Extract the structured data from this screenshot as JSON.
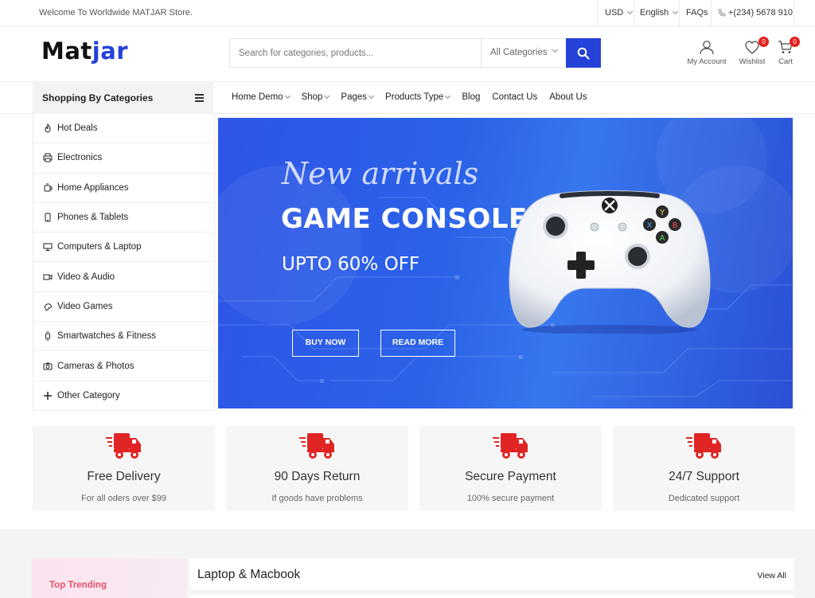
{
  "topbar": {
    "welcome": "Welcome To Worldwide MATJAR Store.",
    "currency": "USD",
    "language": "English",
    "faqs": "FAQs",
    "phone": "+(234) 5678 910"
  },
  "header": {
    "logo_main": "Mat",
    "logo_accent": "jar",
    "search_placeholder": "Search for categories, products...",
    "category_select": "All Categories",
    "account_label": "My Account",
    "wishlist_label": "Wishlist",
    "wishlist_count": "0",
    "cart_label": "Cart",
    "cart_count": "0"
  },
  "categories": {
    "title": "Shopping By Categories",
    "items": [
      {
        "label": "Hot Deals",
        "icon": "fire-icon"
      },
      {
        "label": "Electronics",
        "icon": "printer-icon"
      },
      {
        "label": "Home Appliances",
        "icon": "kettle-icon"
      },
      {
        "label": "Phones & Tablets",
        "icon": "phone-icon"
      },
      {
        "label": "Computers & Laptop",
        "icon": "monitor-icon"
      },
      {
        "label": "Video & Audio",
        "icon": "video-icon"
      },
      {
        "label": "Video Games",
        "icon": "gamepad-icon"
      },
      {
        "label": "Smartwatches & Fitness",
        "icon": "watch-icon"
      },
      {
        "label": "Cameras & Photos",
        "icon": "camera-icon"
      },
      {
        "label": "Other Category",
        "icon": "plus-icon"
      }
    ]
  },
  "nav": {
    "items": [
      {
        "label": "Home Demo",
        "dropdown": true
      },
      {
        "label": "Shop",
        "dropdown": true
      },
      {
        "label": "Pages",
        "dropdown": true
      },
      {
        "label": "Products Type",
        "dropdown": true
      },
      {
        "label": "Blog",
        "dropdown": false
      },
      {
        "label": "Contact Us",
        "dropdown": false
      },
      {
        "label": "About Us",
        "dropdown": false
      }
    ]
  },
  "hero": {
    "tagline": "New arrivals",
    "title": "GAME CONSOLE",
    "subtitle": "UPTO 60% OFF",
    "buy_button": "BUY NOW",
    "read_button": "READ MORE"
  },
  "features": [
    {
      "title": "Free Delivery",
      "subtitle": "For all oders over $99",
      "icon": "truck-icon"
    },
    {
      "title": "90 Days Return",
      "subtitle": "If goods have problems",
      "icon": "truck-icon"
    },
    {
      "title": "Secure Payment",
      "subtitle": "100% secure payment",
      "icon": "truck-icon"
    },
    {
      "title": "24/7 Support",
      "subtitle": "Dedicated support",
      "icon": "truck-icon"
    }
  ],
  "trending": {
    "label": "Top Trending"
  },
  "laptop_section": {
    "title": "Laptop & Macbook",
    "view_all": "View All"
  },
  "colors": {
    "brand": "#2442d8",
    "badge": "#e02020",
    "feature_icon": "#e02424"
  }
}
